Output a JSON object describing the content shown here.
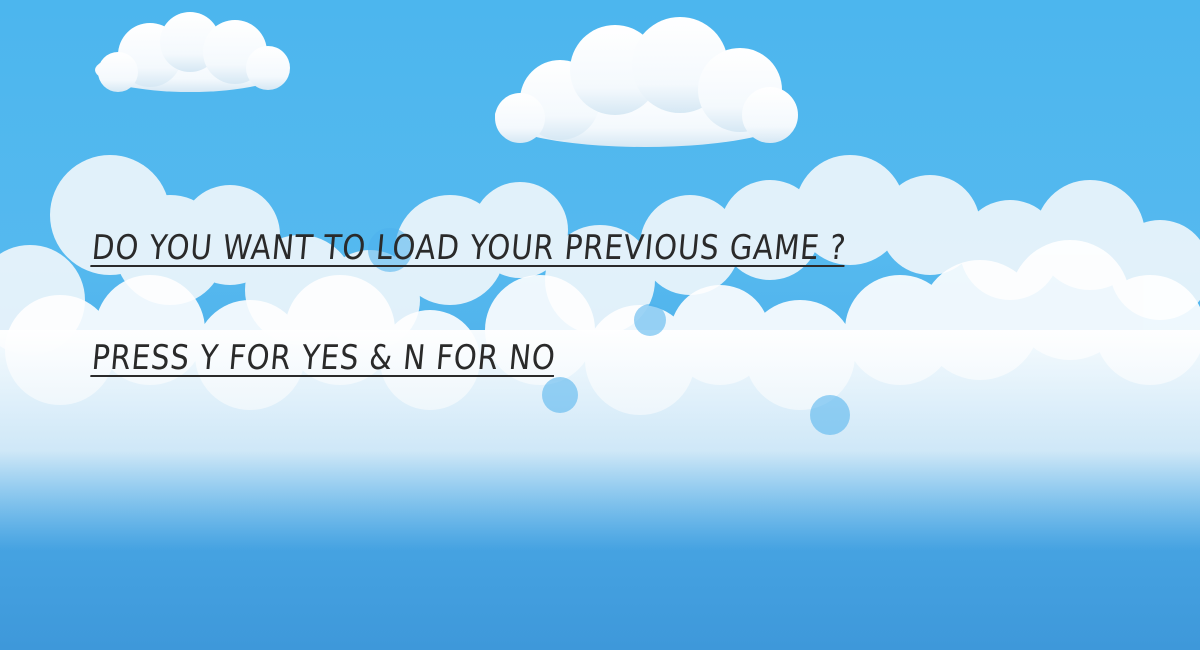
{
  "screen": {
    "question": "DO YOU WANT TO LOAD YOUR PREVIOUS GAME ?",
    "instructions": "PRESS Y FOR YES & N FOR NO"
  },
  "background": {
    "sky_top_color": "#4cb6ee",
    "sky_bottom_color": "#3e98da",
    "cloud_color": "#ffffff",
    "cloud_shadow_color": "#dcecf7"
  },
  "text_color": "#2a2a2a"
}
